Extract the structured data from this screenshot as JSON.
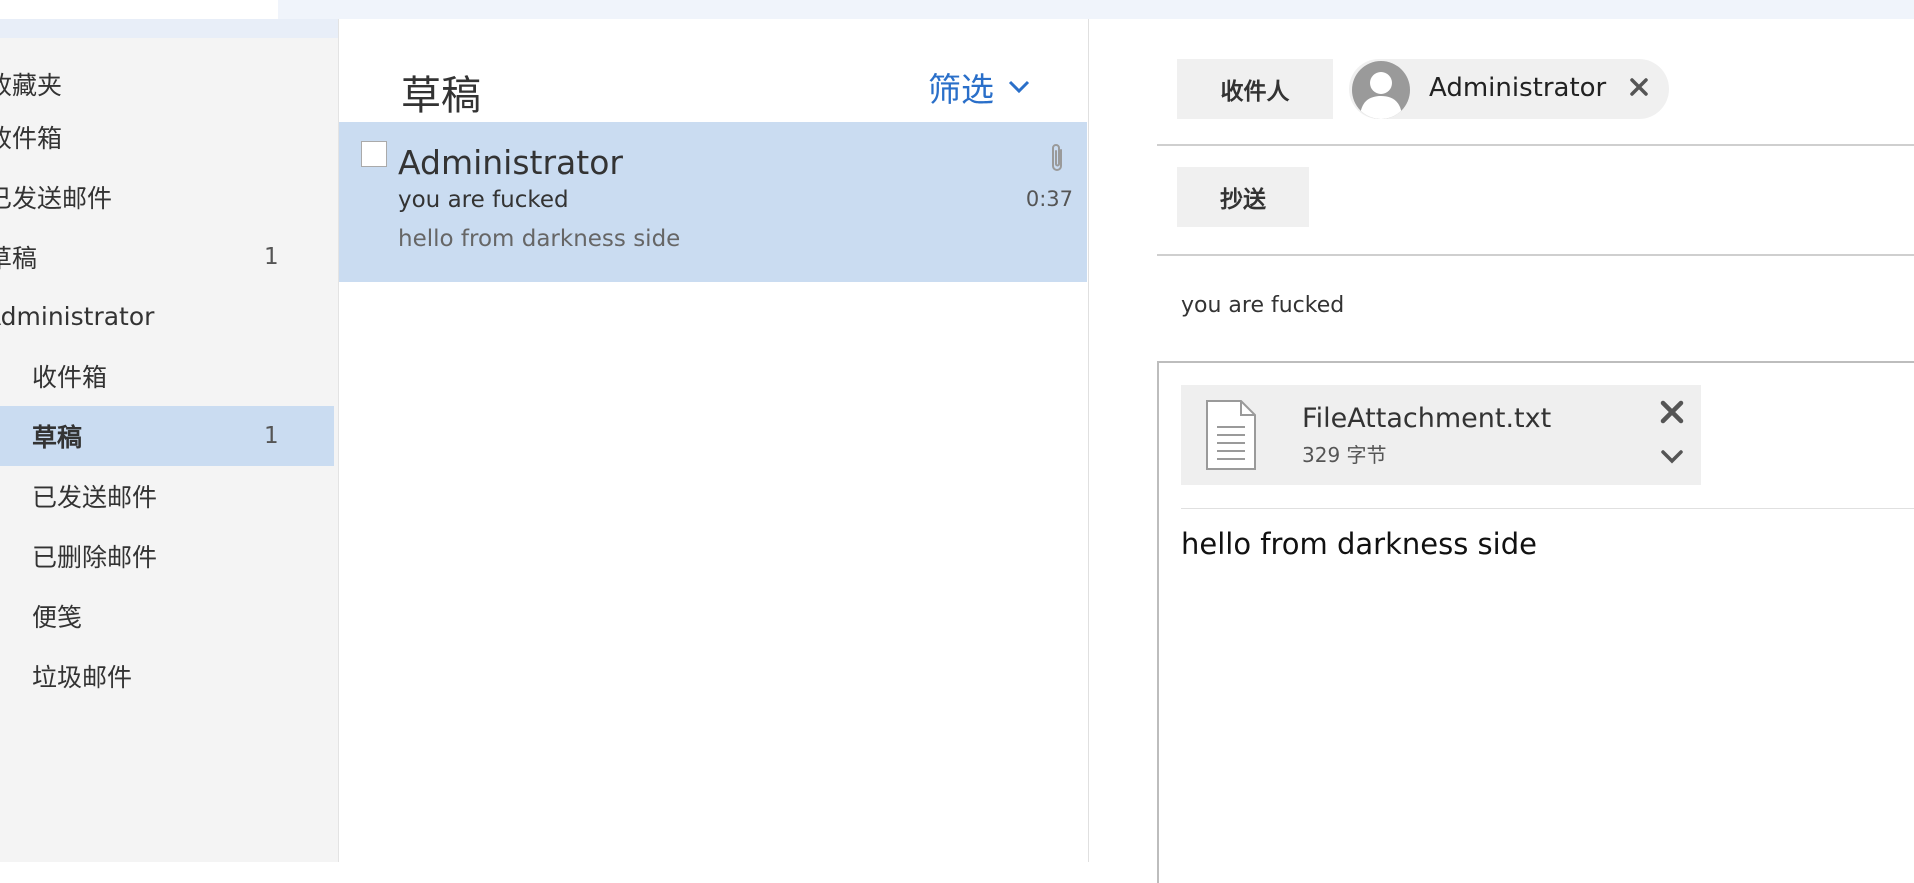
{
  "sidebar": {
    "items": [
      {
        "label": "收藏夹",
        "count": ""
      },
      {
        "label": "收件箱",
        "count": ""
      },
      {
        "label": "已发送邮件",
        "count": ""
      },
      {
        "label": "草稿",
        "count": "1"
      },
      {
        "label": "Administrator",
        "count": ""
      },
      {
        "label": "收件箱",
        "count": ""
      },
      {
        "label": "草稿",
        "count": "1"
      },
      {
        "label": "已发送邮件",
        "count": ""
      },
      {
        "label": "已删除邮件",
        "count": ""
      },
      {
        "label": "便笺",
        "count": ""
      },
      {
        "label": "垃圾邮件",
        "count": ""
      }
    ]
  },
  "list": {
    "title": "草稿",
    "filter_label": "筛选",
    "messages": [
      {
        "from": "Administrator",
        "subject": "you are fucked",
        "preview": "hello from darkness side",
        "time": "0:37",
        "has_attachment": true
      }
    ]
  },
  "compose": {
    "to_label": "收件人",
    "cc_label": "抄送",
    "recipient": "Administrator",
    "subject": "you are fucked",
    "attachment": {
      "name": "FileAttachment.txt",
      "size": "329 字节"
    },
    "body": "hello from darkness side"
  },
  "colors": {
    "accent": "#2a6fc9",
    "selection": "#cadcf1",
    "sidebar_bg": "#f4f4f4"
  }
}
